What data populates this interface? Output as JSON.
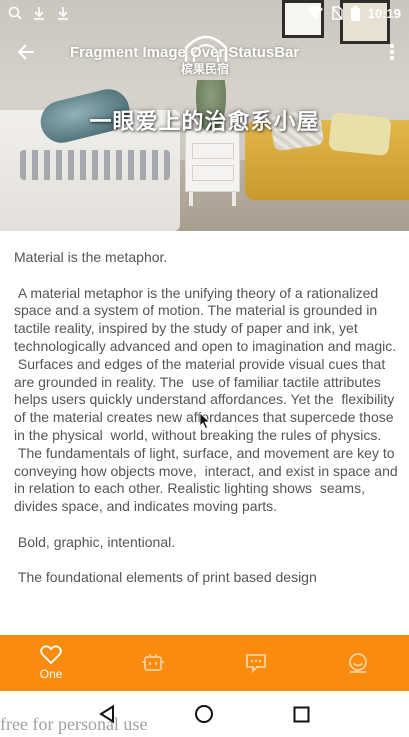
{
  "status_bar": {
    "time": "10:19",
    "icons": [
      "search-icon",
      "download-icon",
      "download-icon",
      "wifi-icon",
      "no-sim-icon",
      "battery-icon"
    ]
  },
  "toolbar": {
    "title": "Fragment Image Over StatusBar",
    "back_icon": "arrow-back-icon",
    "more_icon": "more-vert-icon"
  },
  "hero": {
    "headline": "一眼爱上的治愈系小屋",
    "logo_text": "槟果民宿"
  },
  "content": {
    "paragraphs": [
      "Material is the metaphor.",
      "",
      " A material metaphor is the unifying theory of a rationalized space and a system of motion. The material is grounded in tactile reality, inspired by the study of paper and ink, yet  technologically advanced and open to imagination and magic.\n Surfaces and edges of the material provide visual cues that are grounded in reality. The  use of familiar tactile attributes helps users quickly understand affordances. Yet the  flexibility of the material creates new affordances that supercede those in the physical  world, without breaking the rules of physics.\n The fundamentals of light, surface, and movement are key to conveying how objects move,  interact, and exist in space and in relation to each other. Realistic lighting shows  seams, divides space, and indicates moving parts.",
      "",
      " Bold, graphic, intentional.",
      "",
      " The foundational elements of print based design"
    ]
  },
  "bottom_nav": {
    "accent_color": "#f98c0f",
    "items": [
      {
        "label": "One",
        "icon": "heart-icon",
        "active": true
      },
      {
        "label": "",
        "icon": "robot-icon",
        "active": false
      },
      {
        "label": "",
        "icon": "message-icon",
        "active": false
      },
      {
        "label": "",
        "icon": "face-icon",
        "active": false
      }
    ]
  },
  "system_nav": {
    "icons": [
      "back-triangle-icon",
      "home-circle-icon",
      "recents-square-icon"
    ]
  },
  "watermark": "free for personal use"
}
